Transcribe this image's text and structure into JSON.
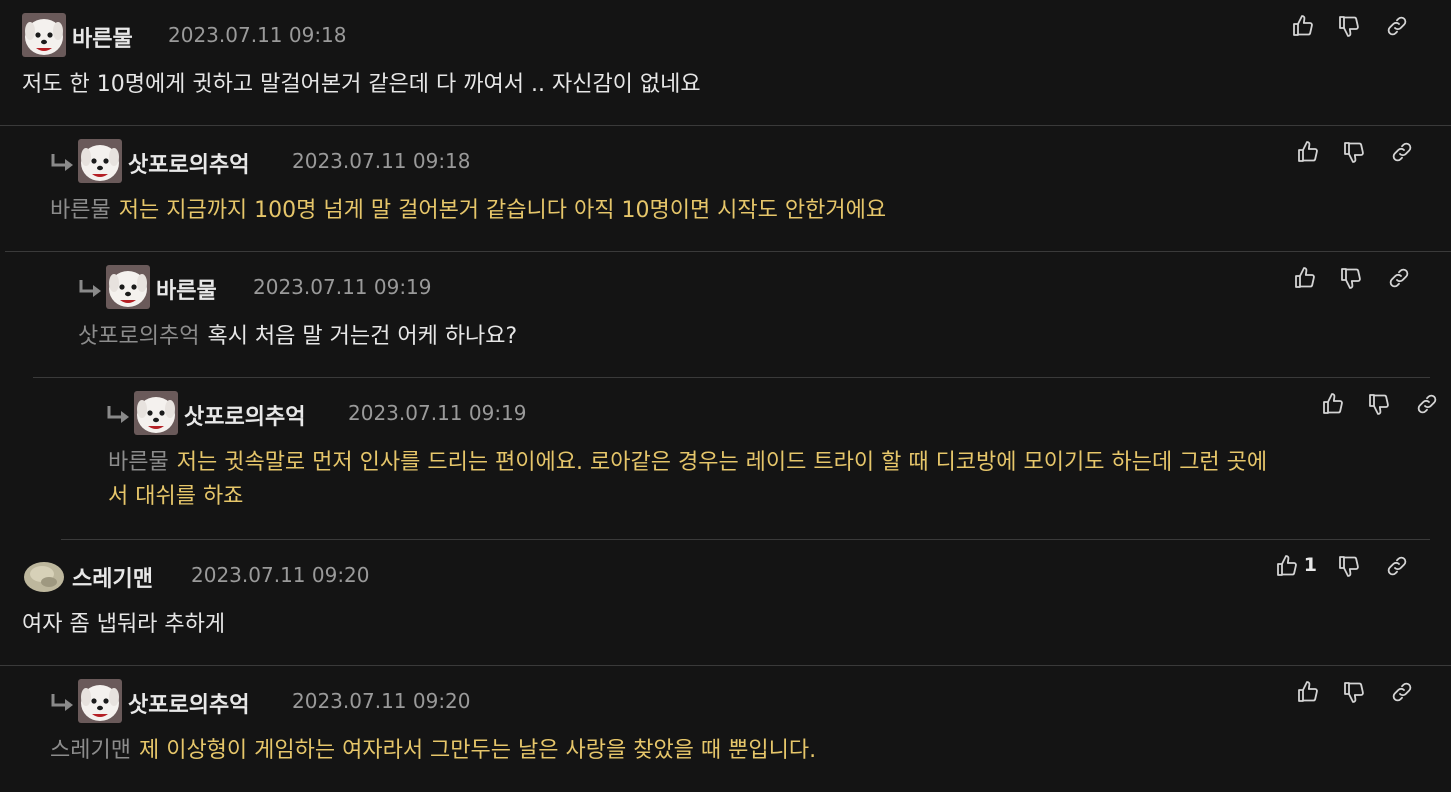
{
  "comments": [
    {
      "nickname": "바른물",
      "date": "2023.07.11 09:18",
      "text": "저도 한 10명에게 귓하고 말걸어본거 같은데 다 까여서 .. 자신감이 없네요",
      "avatar": "dog-avatar"
    },
    {
      "nickname": "삿포로의추억",
      "date": "2023.07.11 09:18",
      "mention": "바른물",
      "text": "저는 지금까지 100명 넘게 말 걸어본거 같습니다 아직 10명이면 시작도 안한거에요",
      "avatar": "dog-avatar"
    },
    {
      "nickname": "바른물",
      "date": "2023.07.11 09:19",
      "mention": "삿포로의추억",
      "text": "혹시 처음 말 거는건 어케 하나요?",
      "avatar": "dog-avatar"
    },
    {
      "nickname": "삿포로의추억",
      "date": "2023.07.11 09:19",
      "mention": "바른물",
      "text": "저는 귓속말로 먼저 인사를 드리는 편이에요. 로아같은 경우는 레이드 트라이 할 때 디코방에 모이기도 하는데 그런 곳에",
      "text_line2": "서 대쉬를 하죠",
      "avatar": "dog-avatar"
    },
    {
      "nickname": "스레기맨",
      "date": "2023.07.11 09:20",
      "like_count": "1",
      "text": "여자 좀 냅둬라 추하게",
      "avatar": "blob-avatar"
    },
    {
      "nickname": "삿포로의추억",
      "date": "2023.07.11 09:20",
      "mention": "스레기맨",
      "text": "제 이상형이 게임하는 여자라서 그만두는 날은 사랑을 찾았을 때 뿐입니다.",
      "avatar": "dog-avatar"
    }
  ],
  "colors": {
    "background": "#141414",
    "reply_text": "#e6c66a",
    "mention": "#8c8c8c",
    "date": "#9a9a9a",
    "divider": "#3a3a3a"
  },
  "icons": {
    "like": "thumbs-up-icon",
    "dislike": "thumbs-down-icon",
    "link": "link-icon",
    "reply": "reply-arrow-icon"
  }
}
